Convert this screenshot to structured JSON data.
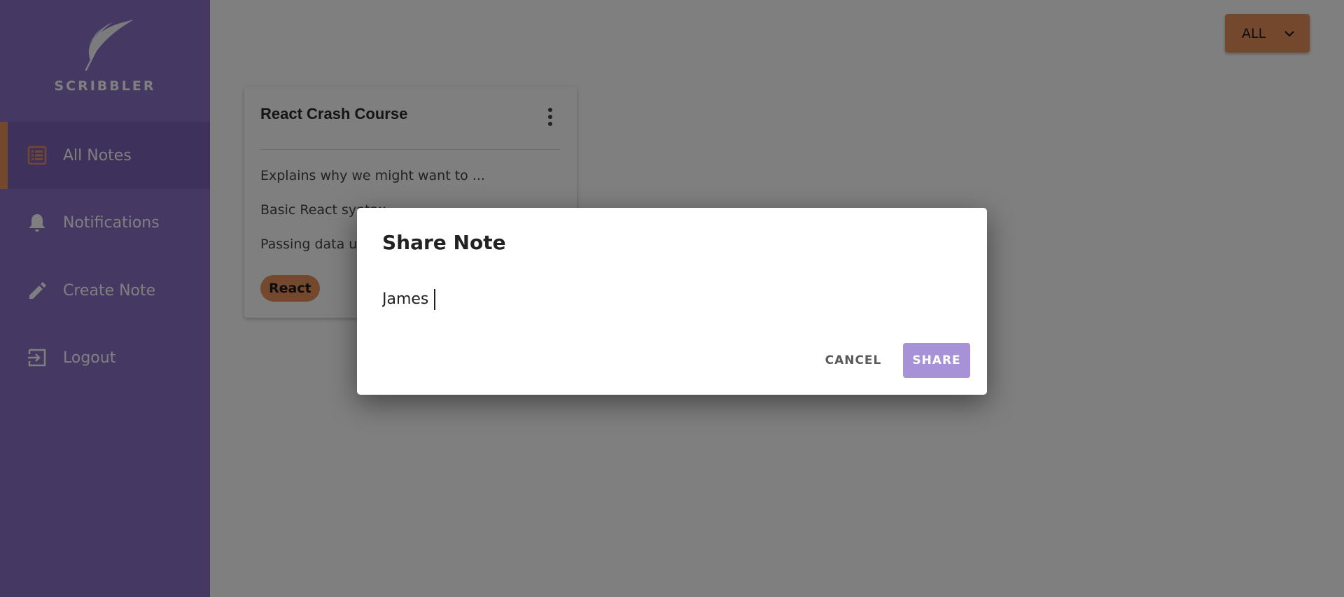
{
  "app": {
    "logo_text": "SCRIBBLER",
    "logo_icon": "quill-icon"
  },
  "sidebar": {
    "items": [
      {
        "label": "All Notes",
        "icon": "list-icon",
        "active": true
      },
      {
        "label": "Notifications",
        "icon": "bell-icon",
        "active": false
      },
      {
        "label": "Create Note",
        "icon": "pencil-icon",
        "active": false
      },
      {
        "label": "Logout",
        "icon": "logout-icon",
        "active": false
      }
    ]
  },
  "filter": {
    "label": "ALL",
    "icon": "chevron-down-icon"
  },
  "note_card": {
    "title": "React Crash Course",
    "lines": [
      "Explains why we might want to ...",
      "Basic React syntax",
      "Passing data using props"
    ],
    "tag": "React"
  },
  "dialog": {
    "title": "Share Note",
    "input_value": "James",
    "cancel_label": "CANCEL",
    "share_label": "SHARE"
  },
  "colors": {
    "sidebar": "#8a70c6",
    "sidebar_active": "#7c62b8",
    "accent": "#e8915a",
    "share_button": "#a792d8",
    "overlay": "rgba(0,0,0,0.5)"
  }
}
